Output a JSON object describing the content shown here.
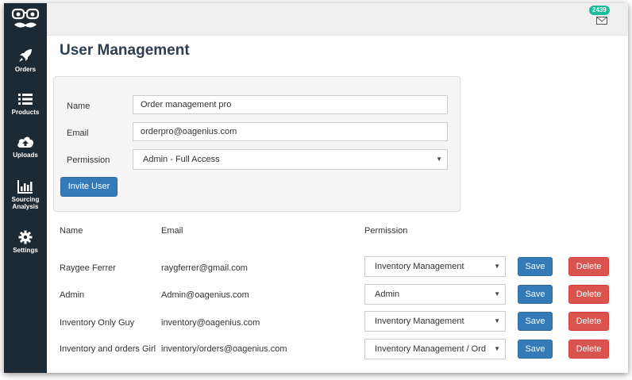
{
  "sidebar": {
    "items": [
      {
        "label": "Orders",
        "icon": "rocket-icon"
      },
      {
        "label": "Products",
        "icon": "list-icon"
      },
      {
        "label": "Uploads",
        "icon": "cloud-upload-icon"
      },
      {
        "label": "Sourcing Analysis",
        "icon": "bar-chart-icon"
      },
      {
        "label": "Settings",
        "icon": "gear-icon"
      }
    ]
  },
  "topbar": {
    "notification_count": "2439"
  },
  "page": {
    "title": "User Management"
  },
  "form": {
    "name_label": "Name",
    "name_value": "Order management pro",
    "email_label": "Email",
    "email_value": "orderpro@oagenius.com",
    "permission_label": "Permission",
    "permission_value": "Admin - Full Access",
    "invite_label": "Invite User"
  },
  "table": {
    "headers": {
      "name": "Name",
      "email": "Email",
      "permission": "Permission"
    },
    "rows": [
      {
        "name": "Raygee Ferrer",
        "email": "raygferrer@gmail.com",
        "permission": "Inventory Management"
      },
      {
        "name": "Admin",
        "email": "Admin@oagenius.com",
        "permission": "Admin"
      },
      {
        "name": "Inventory Only Guy",
        "email": "inventory@oagenius.com",
        "permission": "Inventory Management"
      },
      {
        "name": "Inventory and orders Girl",
        "email": "inventory/orders@oagenius.com",
        "permission": "Inventory Management / Ord"
      }
    ],
    "save_label": "Save",
    "delete_label": "Delete"
  },
  "colors": {
    "sidebar": "#1c2a36",
    "primary": "#337ab7",
    "danger": "#d9534f",
    "badge": "#1abc9c"
  }
}
